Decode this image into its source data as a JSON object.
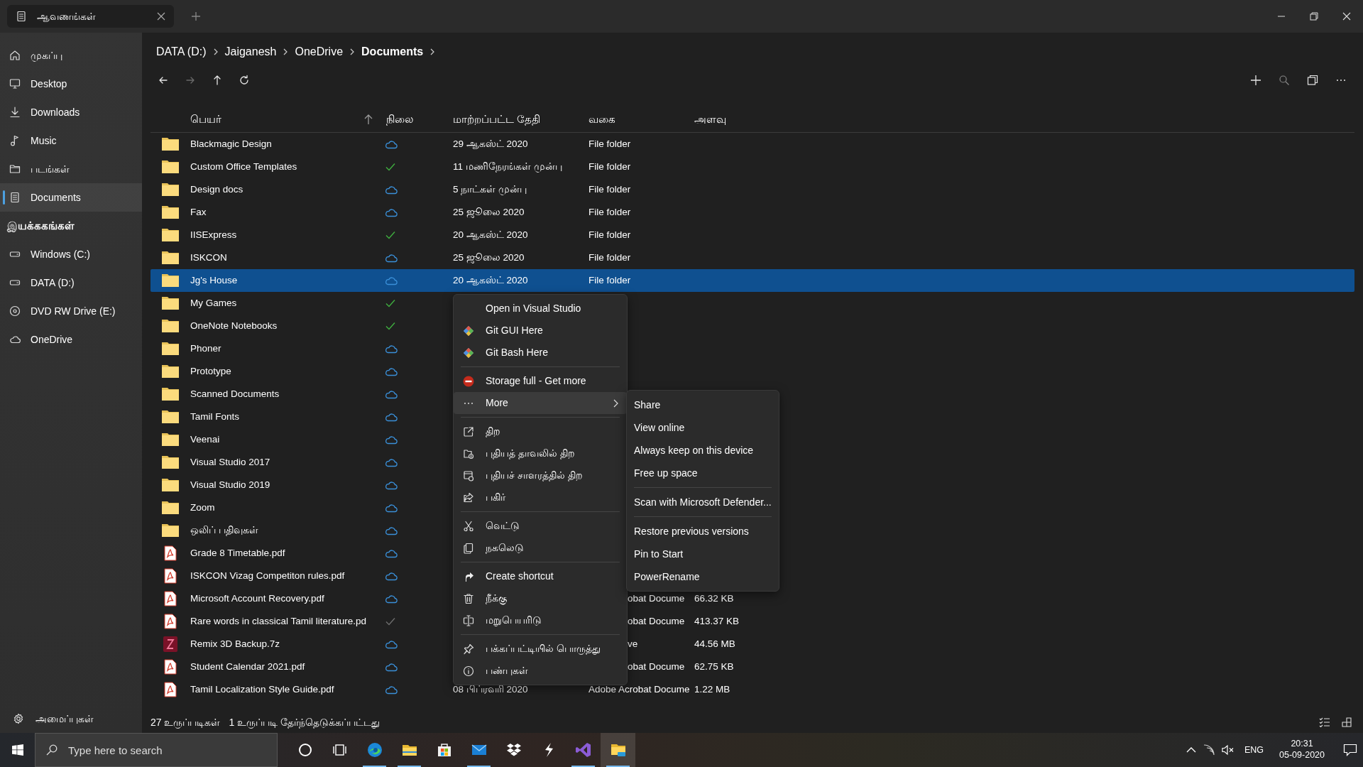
{
  "window": {
    "tab_title": "ஆவணங்கள்"
  },
  "sidebar": {
    "items": [
      {
        "label": "முகப்பு",
        "selected": false
      },
      {
        "label": "Desktop",
        "selected": false
      },
      {
        "label": "Downloads",
        "selected": false
      },
      {
        "label": "Music",
        "selected": false
      },
      {
        "label": "படங்கள்",
        "selected": false
      },
      {
        "label": "Documents",
        "selected": true
      }
    ],
    "drives_heading": "இயக்ககங்கள்",
    "drives": [
      {
        "label": "Windows (C:)",
        "selected": false
      },
      {
        "label": "DATA (D:)",
        "selected": false
      },
      {
        "label": "DVD RW Drive (E:)",
        "selected": false
      },
      {
        "label": "OneDrive",
        "selected": false
      }
    ],
    "settings_label": "அமைப்புகள்"
  },
  "breadcrumb": [
    "DATA (D:)",
    "Jaiganesh",
    "OneDrive",
    "Documents"
  ],
  "nav_buttons": [
    {
      "disabled": false
    },
    {
      "disabled": true
    },
    {
      "disabled": false
    },
    {
      "disabled": false
    }
  ],
  "columns": [
    {
      "label": "பெயர்",
      "sorted": true
    },
    {
      "label": "நிலை",
      "sorted": false
    },
    {
      "label": "மாற்றப்பட்ட தேதி",
      "sorted": false
    },
    {
      "label": "வகை",
      "sorted": false
    },
    {
      "label": "அளவு",
      "sorted": false
    }
  ],
  "rows": [
    {
      "name": "Blackmagic Design",
      "kind": "folder",
      "synced": false,
      "dimmed": false,
      "date": "29 ஆகஸ்ட் 2020",
      "type": "File folder",
      "selected": false
    },
    {
      "name": "Custom Office Templates",
      "kind": "folder",
      "synced": true,
      "dimmed": false,
      "date": "11 மணிநேரங்கள் முன்பு",
      "type": "File folder",
      "selected": false
    },
    {
      "name": "Design docs",
      "kind": "folder",
      "synced": false,
      "dimmed": false,
      "date": "5 நாட்கள் முன்பு",
      "type": "File folder",
      "selected": false
    },
    {
      "name": "Fax",
      "kind": "folder",
      "synced": false,
      "dimmed": false,
      "date": "25 ஜூலை 2020",
      "type": "File folder",
      "selected": false
    },
    {
      "name": "IISExpress",
      "kind": "folder",
      "synced": true,
      "dimmed": false,
      "date": "20 ஆகஸ்ட் 2020",
      "type": "File folder",
      "selected": false
    },
    {
      "name": "ISKCON",
      "kind": "folder",
      "synced": false,
      "dimmed": false,
      "date": "25 ஜூலை 2020",
      "type": "File folder",
      "selected": false
    },
    {
      "name": "Jg's House",
      "kind": "folder",
      "synced": false,
      "dimmed": false,
      "date": "20 ஆகஸ்ட் 2020",
      "type": "File folder",
      "selected": true
    },
    {
      "name": "My Games",
      "kind": "folder",
      "synced": true,
      "dimmed": false,
      "selected": false
    },
    {
      "name": "OneNote Notebooks",
      "kind": "folder",
      "synced": true,
      "dimmed": false,
      "selected": false
    },
    {
      "name": "Phoner",
      "kind": "folder",
      "synced": false,
      "dimmed": false,
      "selected": false
    },
    {
      "name": "Prototype",
      "kind": "folder",
      "synced": false,
      "dimmed": false,
      "selected": false
    },
    {
      "name": "Scanned Documents",
      "kind": "folder",
      "synced": false,
      "dimmed": false,
      "selected": false
    },
    {
      "name": "Tamil Fonts",
      "kind": "folder",
      "synced": false,
      "dimmed": false,
      "selected": false
    },
    {
      "name": "Veenai",
      "kind": "folder",
      "synced": false,
      "dimmed": false,
      "selected": false
    },
    {
      "name": "Visual Studio 2017",
      "kind": "folder",
      "synced": false,
      "dimmed": false,
      "selected": false
    },
    {
      "name": "Visual Studio 2019",
      "kind": "folder",
      "synced": false,
      "dimmed": false,
      "selected": false
    },
    {
      "name": "Zoom",
      "kind": "folder",
      "synced": false,
      "dimmed": false,
      "selected": false
    },
    {
      "name": "ஒலிப் பதிவுகள்",
      "kind": "folder",
      "synced": false,
      "dimmed": false,
      "selected": false
    },
    {
      "name": "Grade 8 Timetable.pdf",
      "kind": "pdf",
      "synced": false,
      "dimmed": false,
      "selected": false
    },
    {
      "name": "ISKCON Vizag Competiton rules.pdf",
      "kind": "pdf",
      "synced": false,
      "dimmed": false,
      "selected": false
    },
    {
      "name": "Microsoft Account Recovery.pdf",
      "kind": "pdf",
      "synced": false,
      "dimmed": false,
      "type": "obat Docume",
      "size": "66.32 KB",
      "selected": false
    },
    {
      "name": "Rare words in classical Tamil literature.pd",
      "kind": "pdf",
      "synced": true,
      "dimmed": true,
      "type": "obat Docume",
      "size": "413.37 KB",
      "selected": false
    },
    {
      "name": "Remix 3D Backup.7z",
      "kind": "archive",
      "synced": false,
      "dimmed": false,
      "type": "ve",
      "size": "44.56 MB",
      "selected": false
    },
    {
      "name": "Student Calendar 2021.pdf",
      "kind": "pdf",
      "synced": false,
      "dimmed": false,
      "type": "obat Docume",
      "size": "62.75 KB",
      "selected": false
    },
    {
      "name": "Tamil Localization Style Guide.pdf",
      "kind": "pdf",
      "synced": false,
      "dimmed": false,
      "date": "08 பிப்ரவரி 2020",
      "type": "Adobe Acrobat Docume",
      "size": "1.22 MB",
      "selected": false
    }
  ],
  "context_menu": {
    "items": [
      {
        "kind": "item",
        "label": "Open in Visual Studio",
        "selected": false
      },
      {
        "kind": "item",
        "label": "Git GUI Here",
        "selected": false
      },
      {
        "kind": "item",
        "label": "Git Bash Here",
        "selected": false
      },
      {
        "kind": "separator"
      },
      {
        "kind": "item",
        "label": "Storage full - Get more",
        "selected": false
      },
      {
        "kind": "item",
        "label": "More",
        "selected": true,
        "has_submenu": true
      },
      {
        "kind": "separator"
      },
      {
        "kind": "item",
        "label": "திற",
        "selected": false
      },
      {
        "kind": "item",
        "label": "புதியத் தாவலில் திற",
        "selected": false
      },
      {
        "kind": "item",
        "label": "புதியச் சாளரத்தில் திற",
        "selected": false
      },
      {
        "kind": "item",
        "label": "பகிர்",
        "selected": false
      },
      {
        "kind": "separator"
      },
      {
        "kind": "item",
        "label": "வெட்டு",
        "selected": false
      },
      {
        "kind": "item",
        "label": "நகலெடு",
        "selected": false
      },
      {
        "kind": "separator"
      },
      {
        "kind": "item",
        "label": "Create shortcut",
        "selected": false
      },
      {
        "kind": "item",
        "label": "நீக்கு",
        "selected": false
      },
      {
        "kind": "item",
        "label": "மறுபெயரிடு",
        "selected": false
      },
      {
        "kind": "separator"
      },
      {
        "kind": "item",
        "label": "பக்கப்பட்டியில் பொருத்து",
        "selected": false
      },
      {
        "kind": "item",
        "label": "பண்புகள்",
        "selected": false
      }
    ]
  },
  "submenu": {
    "items": [
      {
        "kind": "item",
        "label": "Share"
      },
      {
        "kind": "item",
        "label": "View online"
      },
      {
        "kind": "item",
        "label": "Always keep on this device"
      },
      {
        "kind": "item",
        "label": "Free up space"
      },
      {
        "kind": "separator"
      },
      {
        "kind": "item",
        "label": "Scan with Microsoft Defender..."
      },
      {
        "kind": "separator"
      },
      {
        "kind": "item",
        "label": "Restore previous versions"
      },
      {
        "kind": "item",
        "label": "Pin to Start"
      },
      {
        "kind": "item",
        "label": "PowerRename"
      }
    ]
  },
  "status_bar": [
    "27 உருப்படிகள்",
    "1 உருப்படி தேர்ந்தெடுக்கப்பட்டது"
  ],
  "taskbar": {
    "search_placeholder": "Type here to search",
    "apps": [
      {
        "running": false,
        "selected": false
      },
      {
        "running": false,
        "selected": false
      },
      {
        "running": true,
        "selected": false
      },
      {
        "running": true,
        "selected": false
      },
      {
        "running": false,
        "selected": false
      },
      {
        "running": true,
        "selected": false
      },
      {
        "running": false,
        "selected": false
      },
      {
        "running": false,
        "selected": false
      },
      {
        "running": true,
        "selected": false
      },
      {
        "running": true,
        "selected": true
      }
    ],
    "language": "ENG",
    "time": "20:31",
    "date": "05-09-2020"
  }
}
